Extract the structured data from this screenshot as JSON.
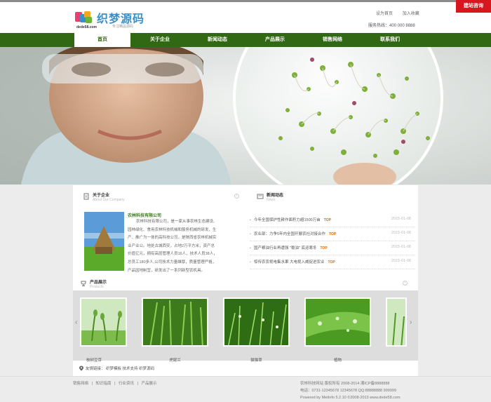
{
  "header": {
    "logo_text": "织梦源码",
    "logo_domain": "dede58.com",
    "logo_slogan": "专注精品源码",
    "set_home": "设为首页",
    "add_fav": "加入收藏",
    "hotline": "服务热线：400 000 8888",
    "builder_button": "建站咨询"
  },
  "nav": {
    "items": [
      {
        "label": "首页"
      },
      {
        "label": "关于企业"
      },
      {
        "label": "新闻动态"
      },
      {
        "label": "产品展示"
      },
      {
        "label": "销售网络"
      },
      {
        "label": "联系我们"
      }
    ]
  },
  "about": {
    "title": "关于企业",
    "subtitle": "About Our Company",
    "company": "农林科技有限公司",
    "text": "农林科技有限公司，是一家从事农林生态建设、园林绿化、食用农林科技机械和服务机械的研发、生产、推广为一体的高科技公司，是陕西省农林机械实业产业公。地处古城西安，占地2万平方米，资产总价值亿元，拥有高层管理人员16人，技术人员38人，总员工180多人,公司技术力量雄厚，质量管理严格，产品因地制宜，研发出了一系列新型农机具。"
  },
  "news": {
    "title": "新闻动态",
    "subtitle": "News",
    "items": [
      {
        "title": "今年全国保护性耕作面积力超1500万亩",
        "top": "TOP",
        "date": "2015-01-08"
      },
      {
        "title": "农业部：力争5年内全国开展农社对接合作",
        "top": "TOP",
        "date": "2015-01-08"
      },
      {
        "title": "国产粮油行业再遭强 \"稳油\" 底迎寒冬",
        "top": "TOP",
        "date": "2015-01-08"
      },
      {
        "title": "惊传农农视电集水果 大电视入威促进农业",
        "top": "TOP",
        "date": "2015-01-08"
      }
    ]
  },
  "products": {
    "title": "产品展示",
    "subtitle": "Products",
    "items": [
      {
        "label": "枝树豆芽"
      },
      {
        "label": "虎尾兰"
      },
      {
        "label": "猫猫草"
      },
      {
        "label": "植物"
      }
    ]
  },
  "links": {
    "text": "友情链接：  织梦模板  技术支持  织梦源码"
  },
  "footer": {
    "nav": [
      "销售网络",
      "|",
      "知识指南",
      "|",
      "行业资讯",
      "|",
      "产品展示"
    ],
    "line1": "农林科技网站 版权所有 2008-2014 湘ICP备8888888",
    "line2": "电话：0731-12345678 12345678 QQ:88888888 999999",
    "line3": "Powered by MetInfo 5.2.10 ©2008-2013 www.dede58.com"
  },
  "colors": {
    "nav_green": "#316813",
    "accent_red": "#d7161d",
    "logo_blue": "#3a8fc9"
  }
}
